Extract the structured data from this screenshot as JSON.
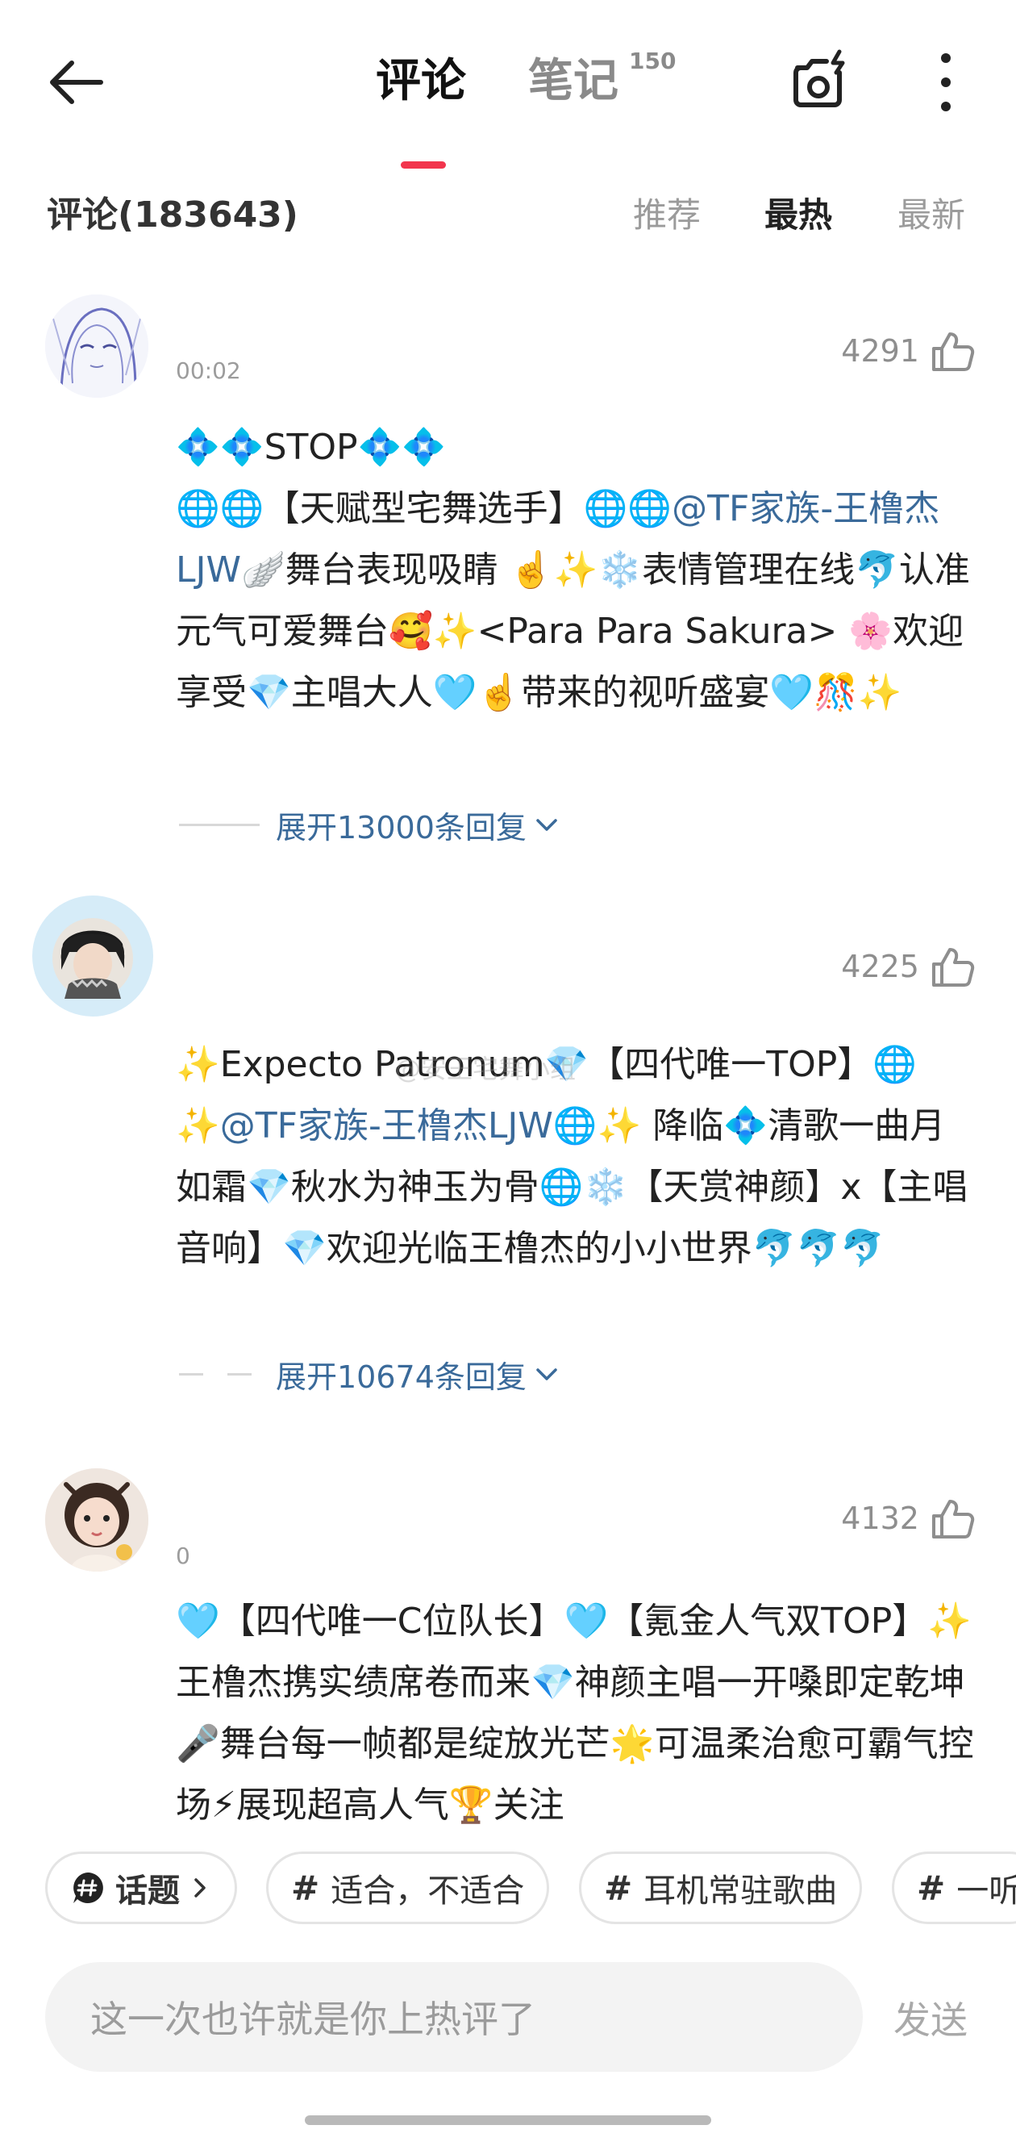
{
  "header": {
    "tabs": [
      {
        "label": "评论",
        "active": true
      },
      {
        "label": "笔记",
        "badge": "150",
        "active": false
      }
    ]
  },
  "sort": {
    "title": "评论(183643)",
    "options": [
      "推荐",
      "最热",
      "最新"
    ],
    "selected": "最热"
  },
  "comments": [
    {
      "time": "00:02",
      "likes": "4291",
      "line1": "💠💠STOP💠💠",
      "line2_a": "🌐🌐【天赋型宅舞选手】🌐🌐",
      "mention": "@TF家族-王橹杰LJW",
      "line2_b": "🪽舞台表现吸睛 ☝️✨❄️表情管理在线🐬认准元气可爱舞台🥰✨<Para Para Sakura> 🌸欢迎享受💎主唱大人🩵☝️带来的视听盛宴🩵🎊✨",
      "expand": "展开13000条回复"
    },
    {
      "likes": "4225",
      "line_a": "✨Expecto Patronum💎【四代唯一TOP】🌐✨",
      "mention": "@TF家族-王橹杰LJW",
      "line_b": "🌐✨ 降临💠清歌一曲月如霜💎秋水为神玉为骨🌐❄️【天赏神颜】x【主唱音响】💎欢迎光临王橹杰的小小世界🐬🐬🐬",
      "expand": "展开10674条回复"
    },
    {
      "time": "0",
      "likes": "4132",
      "text": "🩵【四代唯一C位队长】🩵【氪金人气双TOP】✨王橹杰携实绩席卷而来💎神颜主唱一开嗓即定乾坤🎤舞台每一帧都是绽放光芒🌟可温柔治愈可霸气控场⚡展现超高人气🏆关注"
    }
  ],
  "chips": {
    "topic_label": "话题",
    "items": [
      "适合，不适合",
      "耳机常驻歌曲",
      "一听"
    ]
  },
  "input": {
    "placeholder": "这一次也许就是你上热评了",
    "send_label": "发送"
  },
  "watermark": "@安王宅舞小组",
  "colors": {
    "accent": "#f2354d",
    "link": "#3a6a9a"
  }
}
